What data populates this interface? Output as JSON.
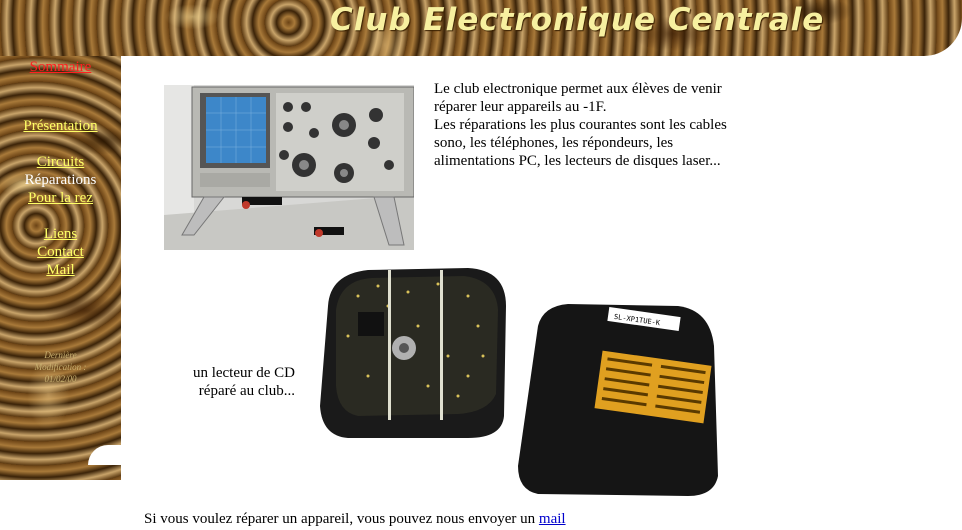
{
  "header": {
    "title": "Club Electronique Centrale"
  },
  "nav": {
    "sommaire": "Sommaire",
    "presentation": "Présentation",
    "circuits": "Circuits",
    "reparations": "Réparations",
    "pour_la_rez": "Pour la rez",
    "liens": "Liens",
    "contact": "Contact",
    "mail": "Mail"
  },
  "sidebar": {
    "modif_label_1": "Dernière",
    "modif_label_2": "Modification :",
    "modif_date": "01/02/00"
  },
  "main": {
    "intro_line1": "Le club electronique permet aux élèves de venir réparer leur appareils au -1F.",
    "intro_line2": "Les réparations les plus courantes sont les cables sono, les téléphones, les répondeurs, les alimentations PC, les lecteurs de disques laser...",
    "caption_line1": "un lecteur de CD",
    "caption_line2": "réparé au club...",
    "footer_text": "Si vous voulez réparer un appareil, vous pouvez nous envoyer un ",
    "footer_link": "mail"
  },
  "images": {
    "photo1": "oscilloscope-photo",
    "photo2": "cd-player-photo",
    "label_text": "SL-XP1TUE-K"
  }
}
